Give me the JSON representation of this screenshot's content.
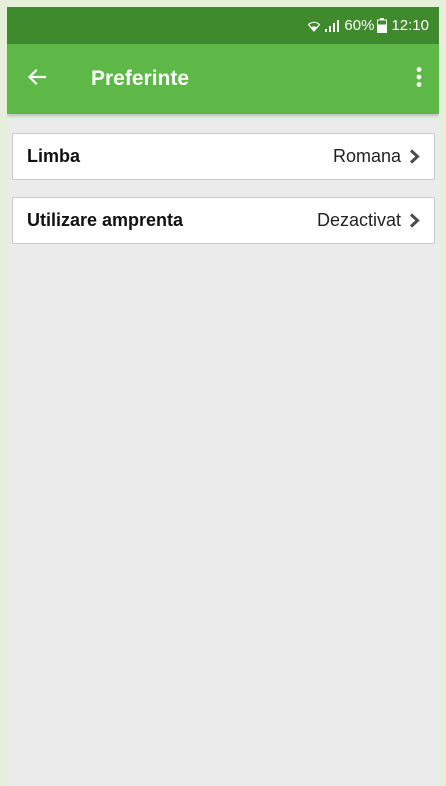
{
  "status_bar": {
    "battery": "60%",
    "time": "12:10",
    "icons": [
      "wifi-icon",
      "signal-icon",
      "battery-icon"
    ]
  },
  "app_bar": {
    "title": "Preferinte",
    "back_icon": "arrow-left-icon",
    "menu_icon": "more-vert-icon"
  },
  "settings": [
    {
      "label": "Limba",
      "value": "Romana"
    },
    {
      "label": "Utilizare amprenta",
      "value": "Dezactivat"
    }
  ],
  "colors": {
    "status_bar": "#3e8a2d",
    "app_bar": "#5db847",
    "background": "#ebebeb",
    "page_border": "#e5efd9"
  }
}
